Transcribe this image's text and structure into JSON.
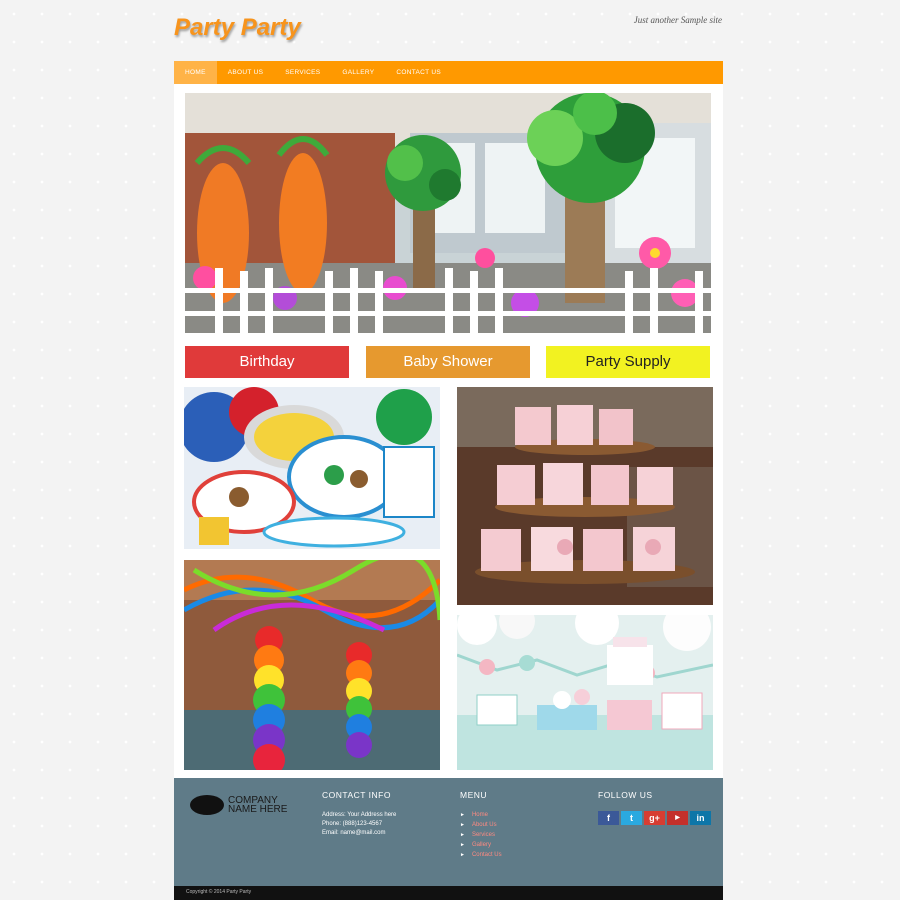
{
  "header": {
    "site_title": "Party Party",
    "tagline": "Just another Sample site"
  },
  "nav": {
    "items": [
      "HOME",
      "ABOUT US",
      "SERVICES",
      "GALLERY",
      "CONTACT US"
    ],
    "active": "HOME"
  },
  "categories": {
    "birthday": "Birthday",
    "baby_shower": "Baby Shower",
    "party_supply": "Party Supply"
  },
  "footer": {
    "company_name": "COMPANY NAME HERE",
    "contact": {
      "heading": "CONTACT INFO",
      "address": "Address: Your Address here",
      "phone": "Phone: (888)123-4567",
      "email": "Email: name@mail.com"
    },
    "menu": {
      "heading": "MENU",
      "items": [
        "Home",
        "About Us",
        "Services",
        "Gallery",
        "Contact Us"
      ]
    },
    "follow": {
      "heading": "FOLLOW US",
      "icons": [
        "facebook-icon",
        "twitter-icon",
        "google-plus-icon",
        "youtube-icon",
        "linkedin-icon"
      ]
    },
    "copyright": "Copyright © 2014 Party Party"
  },
  "colors": {
    "brand_orange": "#ff9900",
    "birthday_red": "#e03a3a",
    "baby_shower_orange": "#e6992f",
    "party_supply_yellow": "#f2f221",
    "footer_slate": "#5f7b88"
  }
}
